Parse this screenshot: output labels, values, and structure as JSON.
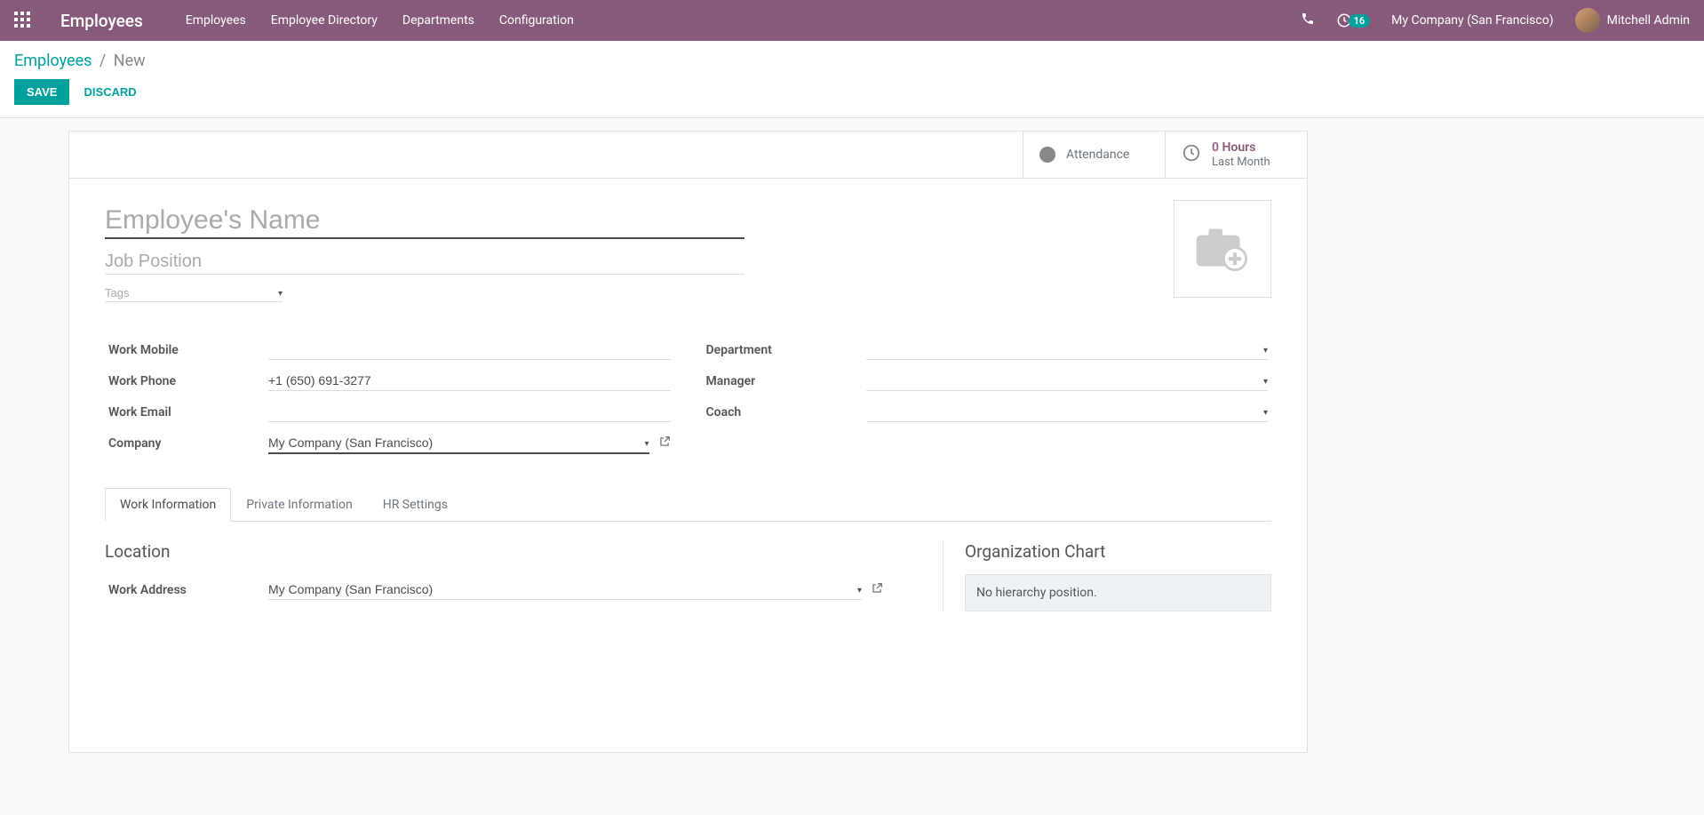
{
  "topbar": {
    "brand": "Employees",
    "menu": [
      "Employees",
      "Employee Directory",
      "Departments",
      "Configuration"
    ],
    "notification_count": "16",
    "company": "My Company (San Francisco)",
    "user": "Mitchell Admin"
  },
  "breadcrumb": {
    "root": "Employees",
    "current": "New"
  },
  "buttons": {
    "save": "SAVE",
    "discard": "DISCARD"
  },
  "stats": {
    "attendance": "Attendance",
    "hours_value": "0 Hours",
    "hours_sub": "Last Month"
  },
  "placeholders": {
    "name": "Employee's Name",
    "job_position": "Job Position",
    "tags": "Tags"
  },
  "labels": {
    "work_mobile": "Work Mobile",
    "work_phone": "Work Phone",
    "work_email": "Work Email",
    "company": "Company",
    "department": "Department",
    "manager": "Manager",
    "coach": "Coach",
    "work_address": "Work Address",
    "location_section": "Location",
    "org_chart_section": "Organization Chart"
  },
  "values": {
    "work_phone": "+1 (650) 691-3277",
    "company": "My Company (San Francisco)",
    "work_address": "My Company (San Francisco)"
  },
  "tabs": {
    "work_info": "Work Information",
    "private_info": "Private Information",
    "hr_settings": "HR Settings"
  },
  "org_chart_msg": "No hierarchy position."
}
